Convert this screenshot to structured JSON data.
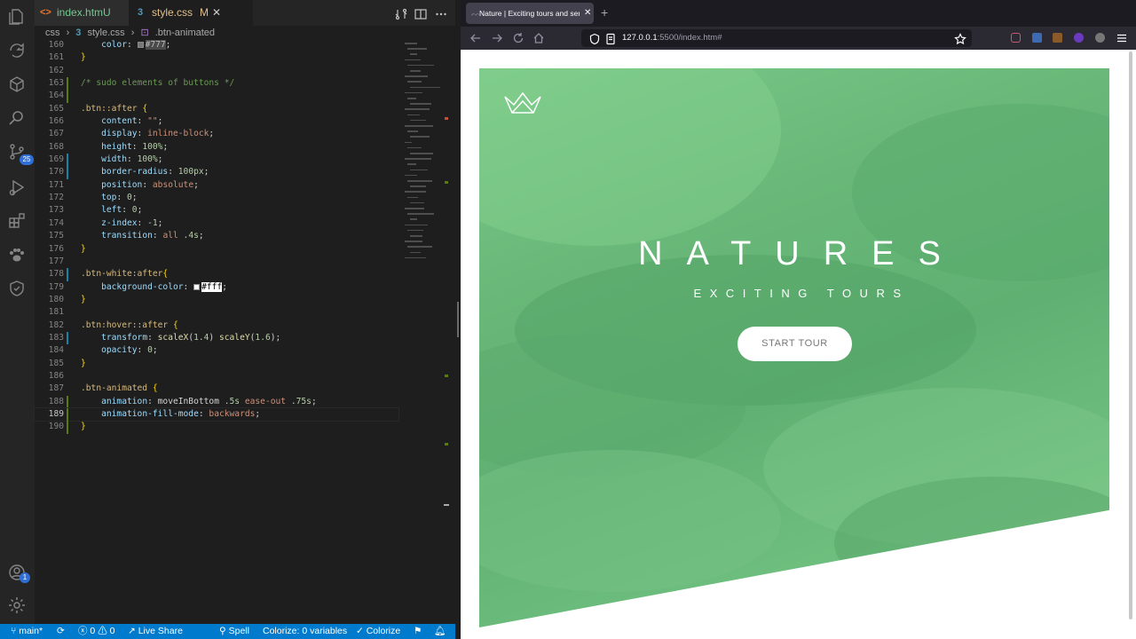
{
  "editor": {
    "tabs": [
      {
        "file": "index.htm",
        "status": "U",
        "icon": "<>"
      },
      {
        "file": "style.css",
        "status": "M",
        "icon": "3"
      }
    ],
    "breadcrumb": {
      "folder": "css",
      "file": "style.css",
      "symbol": ".btn-animated"
    },
    "activity_badges": {
      "source_control": "25",
      "accounts": "1"
    },
    "colors": {
      "added_gutter": "#587c0c",
      "modified_gutter": "#1b81a8",
      "status_bar": "#007acc"
    }
  },
  "code": {
    "l160": {
      "n": "160",
      "prop": "color",
      "val": "#777"
    },
    "l161": {
      "n": "161",
      "t": "}"
    },
    "l162": {
      "n": "162"
    },
    "l163": {
      "n": "163",
      "t": "/* sudo elements of buttons */"
    },
    "l164": {
      "n": "164"
    },
    "l165": {
      "n": "165",
      "sel": ".btn::after",
      "t": " {"
    },
    "l166": {
      "n": "166",
      "prop": "content",
      "val": "\"\""
    },
    "l167": {
      "n": "167",
      "prop": "display",
      "val": "inline-block"
    },
    "l168": {
      "n": "168",
      "prop": "height",
      "val": "100%"
    },
    "l169": {
      "n": "169",
      "prop": "width",
      "val": "100%"
    },
    "l170": {
      "n": "170",
      "prop": "border-radius",
      "val": "100px"
    },
    "l171": {
      "n": "171",
      "prop": "position",
      "val": "absolute"
    },
    "l172": {
      "n": "172",
      "prop": "top",
      "val": "0"
    },
    "l173": {
      "n": "173",
      "prop": "left",
      "val": "0"
    },
    "l174": {
      "n": "174",
      "prop": "z-index",
      "val": "-1"
    },
    "l175": {
      "n": "175",
      "prop": "transition",
      "val1": "all",
      "val2": ".4s"
    },
    "l176": {
      "n": "176",
      "t": "}"
    },
    "l177": {
      "n": "177"
    },
    "l178": {
      "n": "178",
      "sel": ".btn-white:after",
      "t": "{"
    },
    "l179": {
      "n": "179",
      "prop": "background-color",
      "val": "#fff"
    },
    "l180": {
      "n": "180",
      "t": "}"
    },
    "l181": {
      "n": "181"
    },
    "l182": {
      "n": "182",
      "sel": ".btn:hover::after",
      "t": " {"
    },
    "l183": {
      "n": "183",
      "prop": "transform",
      "f1": "scaleX",
      "a1": "1.4",
      "f2": "scaleY",
      "a2": "1.6"
    },
    "l184": {
      "n": "184",
      "prop": "opacity",
      "val": "0"
    },
    "l185": {
      "n": "185",
      "t": "}"
    },
    "l186": {
      "n": "186"
    },
    "l187": {
      "n": "187",
      "sel": ".btn-animated",
      "t": " {"
    },
    "l188": {
      "n": "188",
      "prop": "animation",
      "v1": "moveInBottom",
      "v2": ".5s",
      "v3": "ease-out",
      "v4": ".75s"
    },
    "l189": {
      "n": "189",
      "prop": "animation-fill-mode",
      "val": "backwards"
    },
    "l190": {
      "n": "190",
      "t": "}"
    }
  },
  "status_bar": {
    "branch": "main*",
    "errors": "0",
    "warnings": "0",
    "live_share": "Live Share",
    "spell": "Spell",
    "colorize_vars": "Colorize: 0 variables",
    "colorize": "Colorize"
  },
  "browser": {
    "tab_title": "Nature | Exciting tours and sense",
    "url_host": "127.0.0.1",
    "url_rest": ":5500/index.htm#"
  },
  "page": {
    "title": "NATURES",
    "subtitle": "EXCITING TOURS",
    "cta": "START TOUR",
    "hero_color": "#5fb072"
  }
}
